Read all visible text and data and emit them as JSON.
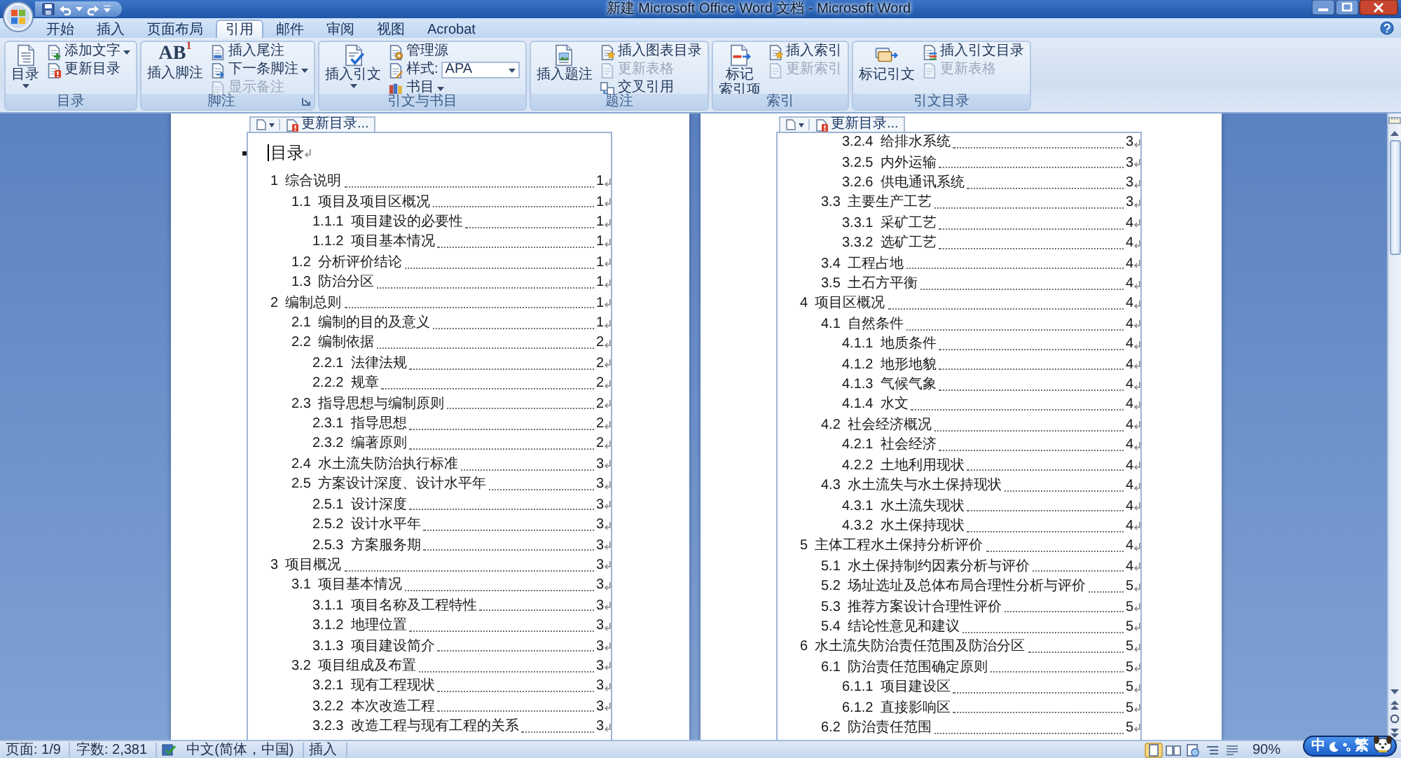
{
  "window": {
    "title": "新建 Microsoft Office Word 文档 - Microsoft Word"
  },
  "tabs": [
    {
      "label": "开始",
      "selected": false
    },
    {
      "label": "插入",
      "selected": false
    },
    {
      "label": "页面布局",
      "selected": false
    },
    {
      "label": "引用",
      "selected": true
    },
    {
      "label": "邮件",
      "selected": false
    },
    {
      "label": "审阅",
      "selected": false
    },
    {
      "label": "视图",
      "selected": false
    },
    {
      "label": "Acrobat",
      "selected": false
    }
  ],
  "ribbon": {
    "groups": [
      {
        "label": "目录",
        "dialog_launcher": false,
        "large": {
          "label": [
            "目录"
          ],
          "dropdown": true
        },
        "small": [
          {
            "kind": "button",
            "label": "添加文字",
            "dropdown": true,
            "disabled": false
          },
          {
            "kind": "button",
            "label": "更新目录",
            "dropdown": false,
            "disabled": false
          }
        ]
      },
      {
        "label": "脚注",
        "dialog_launcher": true,
        "large": {
          "glyph": "AB$^{1}$",
          "label": [
            "插入脚注"
          ],
          "dropdown": false
        },
        "small": [
          {
            "kind": "button",
            "label": "插入尾注",
            "dropdown": false,
            "disabled": false
          },
          {
            "kind": "button",
            "label": "下一条脚注",
            "dropdown": true,
            "disabled": false
          },
          {
            "kind": "button",
            "label": "显示备注",
            "dropdown": false,
            "disabled": true
          }
        ]
      },
      {
        "label": "引文与书目",
        "dialog_launcher": false,
        "large": {
          "label": [
            "插入引文"
          ],
          "dropdown": true
        },
        "small": [
          {
            "kind": "button",
            "label": "管理源",
            "dropdown": false,
            "disabled": false
          },
          {
            "kind": "combo",
            "label": "样式:",
            "value": "APA"
          },
          {
            "kind": "button",
            "label": "书目",
            "dropdown": true,
            "disabled": false
          }
        ]
      },
      {
        "label": "题注",
        "dialog_launcher": false,
        "large": {
          "label": [
            "插入题注"
          ],
          "dropdown": false
        },
        "small": [
          {
            "kind": "button",
            "label": "插入图表目录",
            "dropdown": false,
            "disabled": false
          },
          {
            "kind": "button",
            "label": "更新表格",
            "dropdown": false,
            "disabled": true
          },
          {
            "kind": "button",
            "label": "交叉引用",
            "dropdown": false,
            "disabled": false
          }
        ]
      },
      {
        "label": "索引",
        "dialog_launcher": false,
        "large": {
          "label": [
            "标记",
            "索引项"
          ],
          "dropdown": false
        },
        "small": [
          {
            "kind": "button",
            "label": "插入索引",
            "dropdown": false,
            "disabled": false
          },
          {
            "kind": "button",
            "label": "更新索引",
            "dropdown": false,
            "disabled": true
          }
        ]
      },
      {
        "label": "引文目录",
        "dialog_launcher": false,
        "large": {
          "label": [
            "标记引文"
          ],
          "dropdown": false
        },
        "small": [
          {
            "kind": "button",
            "label": "插入引文目录",
            "dropdown": false,
            "disabled": false
          },
          {
            "kind": "button",
            "label": "更新表格",
            "dropdown": false,
            "disabled": true
          }
        ]
      }
    ]
  },
  "document": {
    "pages": [
      {
        "toc_tab": "更新目录...",
        "heading": "目录",
        "entries": [
          {
            "number": "1",
            "title": "综合说明",
            "page": "1",
            "children": [
              {
                "number": "1.1",
                "title": "项目及项目区概况",
                "page": "1",
                "children": [
                  {
                    "number": "1.1.1",
                    "title": "项目建设的必要性",
                    "page": "1"
                  },
                  {
                    "number": "1.1.2",
                    "title": "项目基本情况",
                    "page": "1"
                  }
                ]
              },
              {
                "number": "1.2",
                "title": "分析评价结论",
                "page": "1"
              },
              {
                "number": "1.3",
                "title": "防治分区",
                "page": "1"
              }
            ]
          },
          {
            "number": "2",
            "title": "编制总则",
            "page": "1",
            "children": [
              {
                "number": "2.1",
                "title": "编制的目的及意义",
                "page": "1"
              },
              {
                "number": "2.2",
                "title": "编制依据",
                "page": "2",
                "children": [
                  {
                    "number": "2.2.1",
                    "title": "法律法规",
                    "page": "2"
                  },
                  {
                    "number": "2.2.2",
                    "title": "规章",
                    "page": "2"
                  }
                ]
              },
              {
                "number": "2.3",
                "title": "指导思想与编制原则",
                "page": "2",
                "children": [
                  {
                    "number": "2.3.1",
                    "title": "指导思想",
                    "page": "2"
                  },
                  {
                    "number": "2.3.2",
                    "title": "编著原则",
                    "page": "2"
                  }
                ]
              },
              {
                "number": "2.4",
                "title": "水土流失防治执行标准",
                "page": "3"
              },
              {
                "number": "2.5",
                "title": "方案设计深度、设计水平年",
                "page": "3",
                "children": [
                  {
                    "number": "2.5.1",
                    "title": "设计深度",
                    "page": "3"
                  },
                  {
                    "number": "2.5.2",
                    "title": "设计水平年",
                    "page": "3"
                  },
                  {
                    "number": "2.5.3",
                    "title": "方案服务期",
                    "page": "3"
                  }
                ]
              }
            ]
          },
          {
            "number": "3",
            "title": "项目概况",
            "page": "3",
            "children": [
              {
                "number": "3.1",
                "title": "项目基本情况",
                "page": "3",
                "children": [
                  {
                    "number": "3.1.1",
                    "title": "项目名称及工程特性",
                    "page": "3"
                  },
                  {
                    "number": "3.1.2",
                    "title": "地理位置",
                    "page": "3"
                  },
                  {
                    "number": "3.1.3",
                    "title": "项目建设简介",
                    "page": "3"
                  }
                ]
              },
              {
                "number": "3.2",
                "title": "项目组成及布置",
                "page": "3",
                "children": [
                  {
                    "number": "3.2.1",
                    "title": "现有工程现状",
                    "page": "3"
                  },
                  {
                    "number": "3.2.2",
                    "title": "本次改造工程",
                    "page": "3"
                  },
                  {
                    "number": "3.2.3",
                    "title": "改造工程与现有工程的关系",
                    "page": "3"
                  }
                ]
              }
            ]
          }
        ]
      },
      {
        "toc_tab": "更新目录...",
        "entries": [
          {
            "children": [
              {
                "children": [
                  {
                    "number": "3.2.4",
                    "title": "给排水系统",
                    "page": "3"
                  },
                  {
                    "number": "3.2.5",
                    "title": "内外运输",
                    "page": "3"
                  },
                  {
                    "number": "3.2.6",
                    "title": "供电通讯系统",
                    "page": "3"
                  }
                ]
              },
              {
                "number": "3.3",
                "title": "主要生产工艺",
                "page": "3",
                "children": [
                  {
                    "number": "3.3.1",
                    "title": "采矿工艺",
                    "page": "4"
                  },
                  {
                    "number": "3.3.2",
                    "title": "选矿工艺",
                    "page": "4"
                  }
                ]
              },
              {
                "number": "3.4",
                "title": "工程占地",
                "page": "4"
              },
              {
                "number": "3.5",
                "title": "土石方平衡",
                "page": "4"
              }
            ]
          },
          {
            "number": "4",
            "title": "项目区概况",
            "page": "4",
            "children": [
              {
                "number": "4.1",
                "title": "自然条件",
                "page": "4",
                "children": [
                  {
                    "number": "4.1.1",
                    "title": "地质条件",
                    "page": "4"
                  },
                  {
                    "number": "4.1.2",
                    "title": "地形地貌",
                    "page": "4"
                  },
                  {
                    "number": "4.1.3",
                    "title": "气候气象",
                    "page": "4"
                  },
                  {
                    "number": "4.1.4",
                    "title": "水文",
                    "page": "4"
                  }
                ]
              },
              {
                "number": "4.2",
                "title": "社会经济概况",
                "page": "4",
                "children": [
                  {
                    "number": "4.2.1",
                    "title": "社会经济",
                    "page": "4"
                  },
                  {
                    "number": "4.2.2",
                    "title": "土地利用现状",
                    "page": "4"
                  }
                ]
              },
              {
                "number": "4.3",
                "title": "水土流失与水土保持现状",
                "page": "4",
                "children": [
                  {
                    "number": "4.3.1",
                    "title": "水土流失现状",
                    "page": "4"
                  },
                  {
                    "number": "4.3.2",
                    "title": "水土保持现状",
                    "page": "4"
                  }
                ]
              }
            ]
          },
          {
            "number": "5",
            "title": "主体工程水土保持分析评价",
            "page": "4",
            "children": [
              {
                "number": "5.1",
                "title": "水土保持制约因素分析与评价",
                "page": "4"
              },
              {
                "number": "5.2",
                "title": "场址选址及总体布局合理性分析与评价",
                "page": "5"
              },
              {
                "number": "5.3",
                "title": "推荐方案设计合理性评价",
                "page": "5"
              },
              {
                "number": "5.4",
                "title": "结论性意见和建议",
                "page": "5"
              }
            ]
          },
          {
            "number": "6",
            "title": "水土流失防治责任范围及防治分区",
            "page": "5",
            "children": [
              {
                "number": "6.1",
                "title": "防治责任范围确定原则",
                "page": "5",
                "children": [
                  {
                    "number": "6.1.1",
                    "title": "项目建设区",
                    "page": "5"
                  },
                  {
                    "number": "6.1.2",
                    "title": "直接影响区",
                    "page": "5"
                  }
                ]
              },
              {
                "number": "6.2",
                "title": "防治责任范围",
                "page": "5"
              }
            ]
          }
        ]
      }
    ]
  },
  "status_bar": {
    "page": "页面: 1/9",
    "words": "字数: 2,381",
    "language": "中文(简体，中国)",
    "mode": "插入",
    "views": [
      {
        "selected": true
      },
      {
        "selected": false
      },
      {
        "selected": false
      },
      {
        "selected": false
      },
      {
        "selected": false
      }
    ],
    "zoom": "90%"
  },
  "ime": {
    "mode": "中",
    "script": "繁"
  }
}
